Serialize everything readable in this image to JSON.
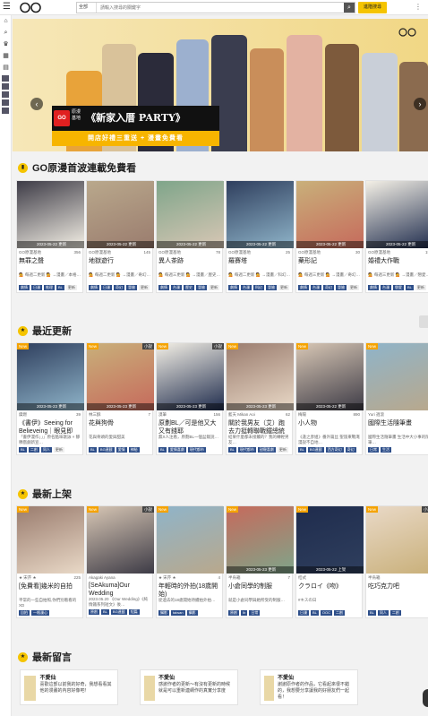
{
  "header": {
    "search_scope": "全部",
    "search_placeholder": "請輸入搜尋的關鍵字",
    "advanced_label": "進階搜尋"
  },
  "banner": {
    "brand_line1": "原漫",
    "brand_line2": "基地",
    "title": "《新家入厝 PARTY》",
    "subtitle": "開店好禮三重送 + 漫畫免費看"
  },
  "sections": {
    "go": {
      "title": "GO原漫首波連載免費看"
    },
    "recent": {
      "title": "最近更新"
    },
    "new": {
      "title": "最新上架"
    },
    "comments": {
      "title": "最新留言"
    }
  },
  "go_cards": [
    {
      "date": "2023-05-22 更新",
      "author": "GO原漫基地",
      "count": "356",
      "title": "無罪之聲",
      "desc": "💁 每週二更新 💁 →漫畫／本格…",
      "tags": [
        "劇情",
        "日漫",
        "推理",
        "BL"
      ],
      "extra": "更新"
    },
    {
      "date": "2023-05-22 更新",
      "author": "GO原漫基地",
      "count": "145",
      "title": "地獄遊行",
      "desc": "💁 每週二更新 💁 →漫畫／奇幻…",
      "tags": [
        "劇情",
        "日漫",
        "奇幻",
        "冒險"
      ],
      "extra": "更新"
    },
    {
      "date": "2023-05-22 更新",
      "author": "GO原漫基地",
      "count": "78",
      "title": "異人茶跡",
      "desc": "💁 每週三更新 💁 →漫畫／歷史…",
      "tags": [
        "劇情",
        "台漫",
        "歷史",
        "冒險"
      ],
      "extra": "更新"
    },
    {
      "date": "2023-05-22 更新",
      "author": "GO原漫基地",
      "count": "25",
      "title": "羅賽塔",
      "desc": "💁 每週二更新 💁 →漫畫／科幻…",
      "tags": [
        "劇情",
        "台漫",
        "科幻",
        "冒險"
      ],
      "extra": "更新"
    },
    {
      "date": "2023-05-22 更新",
      "author": "GO原漫基地",
      "count": "30",
      "title": "藥形記",
      "desc": "💁 每週三更新 💁 →漫畫／奇幻…",
      "tags": [
        "劇情",
        "台漫",
        "奇幻",
        "冒險"
      ],
      "extra": "更新"
    },
    {
      "date": "2023-05-22 更新",
      "author": "GO原漫基地",
      "count": "15",
      "title": "婚禮大作戰",
      "desc": "💁 每週三更新 💁 →漫畫／戀愛…",
      "tags": [
        "劇情",
        "台漫",
        "戀愛",
        "BL"
      ],
      "extra": "更新"
    }
  ],
  "recent_cards": [
    {
      "new": "New",
      "right": "",
      "date": "2023-05-23 更新",
      "author": "燦燃",
      "count": "39",
      "title": "《書伊》Seeing for Believeing｜眼見即為…",
      "desc": "「書伊漫作」」」原名酷味歌詠 × 靜穆戲劇新宣…",
      "tags": [
        "BL",
        "二創",
        "同人"
      ],
      "extra": "更新"
    },
    {
      "new": "New",
      "right": "小說",
      "date": "2023-05-23 更新",
      "author": "林三酥",
      "count": "7",
      "title": "花與狗骨",
      "desc": "花與骨頭的愛與甜美",
      "tags": [
        "BL",
        "BG連載",
        "愛情",
        "神秘"
      ],
      "extra": ""
    },
    {
      "new": "New",
      "right": "小說",
      "date": "2023-05-23 更新",
      "author": "漠筆",
      "count": "156",
      "title": "原劃BL／可是他又大又有錢耶",
      "desc": "無X人注看，原劃BL一個盆栽說…",
      "tags": [
        "BL",
        "愛情喜劇",
        "現代都市"
      ],
      "extra": ""
    },
    {
      "new": "New",
      "right": "",
      "date": "2023-05-23 更新",
      "author": "藍天 Mikan Aoi",
      "count": "62",
      "title": "關於我男友（艾）跑去力挺轉聯戰鐵總統找你事…",
      "desc": "結果什麼都未接觸的？我的轉輕男友…",
      "tags": [
        "BL",
        "現代都市",
        "甜寵喜劇"
      ],
      "extra": "更新"
    },
    {
      "new": "New",
      "right": "",
      "date": "2023-05-22 更新",
      "author": "梅陽",
      "count": "890",
      "title": "小人物",
      "desc": "《逢之彦姐》番外篇丝 聖旅東戰淹漫說不自地…",
      "tags": [
        "BL",
        "BG連載",
        "西方奇幻",
        "奇幻"
      ],
      "extra": ""
    },
    {
      "new": "New",
      "right": "",
      "date": "",
      "author": "Yuri 週滾",
      "count": "",
      "title": "國際生活隨筆畫",
      "desc": "國際生活隨筆畫 生活中大小事的隨筆…",
      "tags": [
        "日常",
        "生活"
      ],
      "extra": ""
    }
  ],
  "new_cards": [
    {
      "new": "New",
      "right": "",
      "date": "",
      "author": "★ 宋芹 ★",
      "count": "225",
      "title": "[免費看]幾米的自拍",
      "desc": "平常的一些自拍照,你們別看看的XD",
      "tags": [
        "自拍",
        "一格漫心"
      ],
      "extra": ""
    },
    {
      "new": "New",
      "right": "小說",
      "date": "",
      "author": "Akagaki Ayana",
      "count": "",
      "title": "[SeAkuma]Our Wedding",
      "desc": "2023.05.20 《Our Wedding》《純情鐵系列短文》後…",
      "tags": [
        "原創",
        "BL",
        "BG連載",
        "短篇"
      ],
      "extra": ""
    },
    {
      "new": "New",
      "right": "",
      "date": "",
      "author": "★ 宋芹 ★",
      "count": "4",
      "title": "年輕時的外拍(18歲開始)",
      "desc": "從過去的18歲開始持續拍外拍…",
      "tags": [
        "攝影",
        "taiwan",
        "攝影"
      ],
      "extra": ""
    },
    {
      "new": "New",
      "right": "",
      "date": "2023-05-23 更新",
      "author": "半烏箱",
      "count": "7",
      "title": "小倉同學的制服",
      "desc": "就是小倉同學與她所受的制服…",
      "tags": [
        "原創",
        "Ib",
        "日常"
      ],
      "extra": ""
    },
    {
      "new": "New",
      "right": "",
      "date": "2023-05-22 上架",
      "author": "桔式",
      "count": "",
      "title": "クラロイ《吻》",
      "desc": "#キスの日",
      "tags": [
        "日漫",
        "BL",
        "OOC",
        "二創"
      ],
      "extra": ""
    },
    {
      "new": "New",
      "right": "小說",
      "date": "",
      "author": "半烏箱",
      "count": "",
      "title": "吃巧克力吧",
      "desc": "",
      "tags": [
        "BL",
        "同人",
        "二創"
      ],
      "extra": ""
    }
  ],
  "comments": [
    {
      "name": "不愛仙",
      "text": "喜歡這部以前我的好奇，我想看看其他的漫畫的內容好像吧！"
    },
    {
      "name": "不愛仙",
      "text": "感謝作者的更新～有沒有更新的時候就是可以重新連網作的真實分享度"
    },
    {
      "name": "不愛仙",
      "text": "謝謝原作者的作品，它看起來很不錯的，我想要分享讓我的好朋友們一起看！"
    }
  ]
}
